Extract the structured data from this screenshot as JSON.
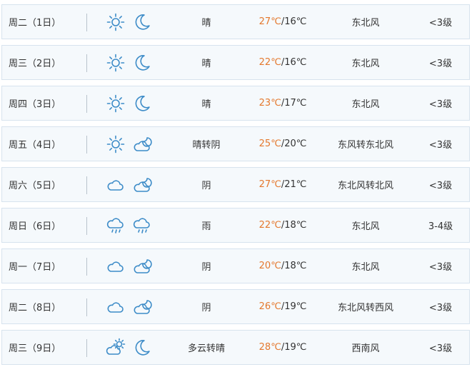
{
  "style": {
    "icon_color": "#3d8cc8",
    "high_temp_color": "#e4782d",
    "text_color": "#333333",
    "row_bg": "#f5f9fc",
    "row_border": "#d7e3ee"
  },
  "rows": [
    {
      "day": "周二（1日）",
      "day_icon": "sun-icon",
      "night_icon": "moon-icon",
      "condition": "晴",
      "high": "27℃",
      "low": "/16℃",
      "wind": "东北风",
      "level": "<3级"
    },
    {
      "day": "周三（2日）",
      "day_icon": "sun-icon",
      "night_icon": "moon-icon",
      "condition": "晴",
      "high": "22℃",
      "low": "/16℃",
      "wind": "东北风",
      "level": "<3级"
    },
    {
      "day": "周四（3日）",
      "day_icon": "sun-icon",
      "night_icon": "moon-icon",
      "condition": "晴",
      "high": "23℃",
      "low": "/17℃",
      "wind": "东北风",
      "level": "<3级"
    },
    {
      "day": "周五（4日）",
      "day_icon": "sun-icon",
      "night_icon": "cloudy-night-icon",
      "condition": "晴转阴",
      "high": "25℃",
      "low": "/20℃",
      "wind": "东风转东北风",
      "level": "<3级"
    },
    {
      "day": "周六（5日）",
      "day_icon": "cloud-icon",
      "night_icon": "cloudy-night-icon",
      "condition": "阴",
      "high": "27℃",
      "low": "/21℃",
      "wind": "东北风转北风",
      "level": "<3级"
    },
    {
      "day": "周日（6日）",
      "day_icon": "rain-icon",
      "night_icon": "rain-icon",
      "condition": "雨",
      "high": "22℃",
      "low": "/18℃",
      "wind": "东北风",
      "level": "3-4级"
    },
    {
      "day": "周一（7日）",
      "day_icon": "cloud-icon",
      "night_icon": "cloudy-night-icon",
      "condition": "阴",
      "high": "20℃",
      "low": "/18℃",
      "wind": "东北风",
      "level": "<3级"
    },
    {
      "day": "周二（8日）",
      "day_icon": "cloud-icon",
      "night_icon": "cloudy-night-icon",
      "condition": "阴",
      "high": "26℃",
      "low": "/19℃",
      "wind": "东北风转西风",
      "level": "<3级"
    },
    {
      "day": "周三（9日）",
      "day_icon": "partly-cloudy-icon",
      "night_icon": "moon-icon",
      "condition": "多云转晴",
      "high": "28℃",
      "low": "/19℃",
      "wind": "西南风",
      "level": "<3级"
    }
  ]
}
